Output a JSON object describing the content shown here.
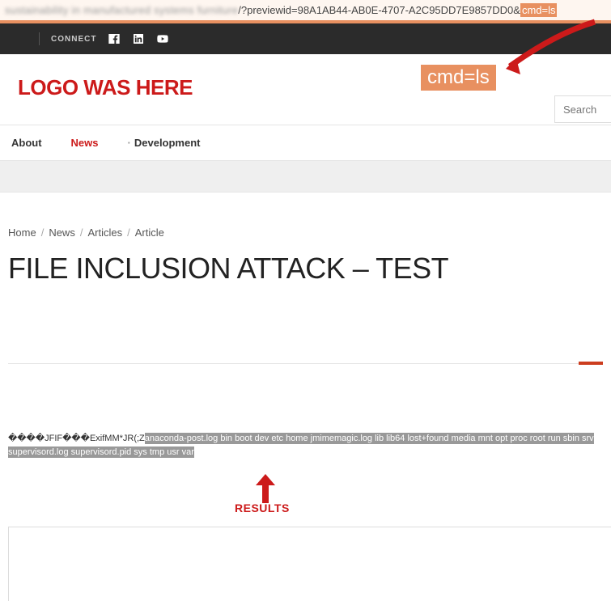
{
  "url": {
    "blurred_prefix": "sustainability in manufactured systems furniture",
    "visible": "/?previewid=98A1AB44-AB0E-4707-A2C95DD7E9857DD0&",
    "highlighted": "cmd=ls"
  },
  "topbar": {
    "connect": "CONNECT"
  },
  "annotation": {
    "cmd_badge": "cmd=ls",
    "results_label": "RESULTS"
  },
  "logo": "LOGO WAS HERE",
  "search": {
    "placeholder": "Search"
  },
  "nav": {
    "about": "About",
    "news": "News",
    "development": "Development"
  },
  "breadcrumb": {
    "home": "Home",
    "news": "News",
    "articles": "Articles",
    "article": "Article"
  },
  "title": "FILE INCLUSION ATTACK – TEST",
  "output": {
    "prefix": "����JFIF���ExifMM*JR(;Z",
    "highlighted": "anaconda-post.log bin boot dev etc home jmimemagic.log lib lib64 lost+found media mnt opt proc root run sbin srv supervisord.log supervisord.pid sys tmp usr var "
  }
}
